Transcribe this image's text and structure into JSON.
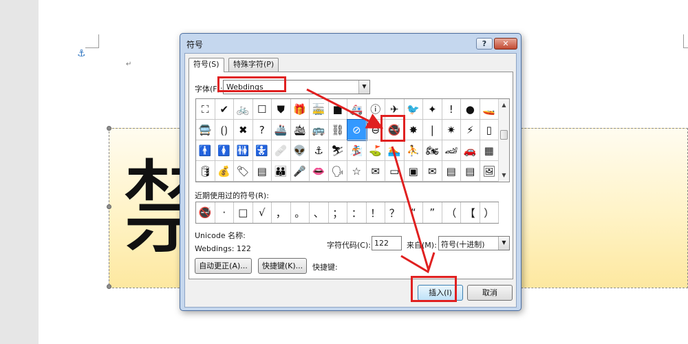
{
  "dialog": {
    "title": "符号",
    "help_label": "?",
    "close_label": "✕"
  },
  "tabs": [
    {
      "label": "符号(S)",
      "active": true
    },
    {
      "label": "特殊字符(P)",
      "active": false
    }
  ],
  "font": {
    "label": "字体(F):",
    "value": "Webdings"
  },
  "symbol_grid": {
    "selected_index": 24,
    "rows": [
      [
        "⛶",
        "✔",
        "🚲",
        "☐",
        "⛊",
        "🎁",
        "🚋",
        "■",
        "🚑",
        "ⓘ",
        "✈",
        "🐦",
        "✦",
        "!",
        "●",
        "🚤"
      ],
      [
        "🚍",
        "⟮⟯",
        "✖",
        "?",
        "🚢",
        "🛳",
        "🚌",
        "⛓",
        "⊘",
        "⊖",
        "🚭",
        "✸",
        "|",
        "✷",
        "⚡",
        "▯"
      ],
      [
        "🚹",
        "🚺",
        "🚻",
        "🚼",
        "🩹",
        "👽",
        "⚓",
        "⛷",
        "🏂",
        "⛳",
        "🏊",
        "⛹",
        "🏍",
        "🏎",
        "🚗",
        "▦"
      ],
      [
        "🛢",
        "💰",
        "🏷",
        "▤",
        "👪",
        "🎤",
        "👄",
        "🗣",
        "☆",
        "✉",
        "▭",
        "▣",
        "✉",
        "▤",
        "▤",
        "🖼"
      ]
    ]
  },
  "recent": {
    "label": "近期使用过的符号(R):",
    "symbols": [
      "🚭",
      "·",
      "□",
      "√",
      "，",
      "。",
      "、",
      "；",
      "：",
      "！",
      "？",
      "“",
      "”",
      "（",
      "【",
      "）"
    ]
  },
  "unicode": {
    "name_label": "Unicode 名称:",
    "name_value": "Webdings: 122"
  },
  "code": {
    "label": "字符代码(C):",
    "value": "122"
  },
  "from": {
    "label": "来自(M):",
    "value": "符号(十进制)"
  },
  "buttons": {
    "autocorrect": "自动更正(A)...",
    "shortcut_key": "快捷键(K)...",
    "shortcut_label": "快捷键:",
    "insert": "插入(I)",
    "cancel": "取消"
  },
  "document": {
    "big_char": "禁",
    "para_mark": "↵",
    "anchor_icon": "anchor-icon"
  },
  "colors": {
    "annotation": "#e02020",
    "selection": "#3399ff"
  }
}
